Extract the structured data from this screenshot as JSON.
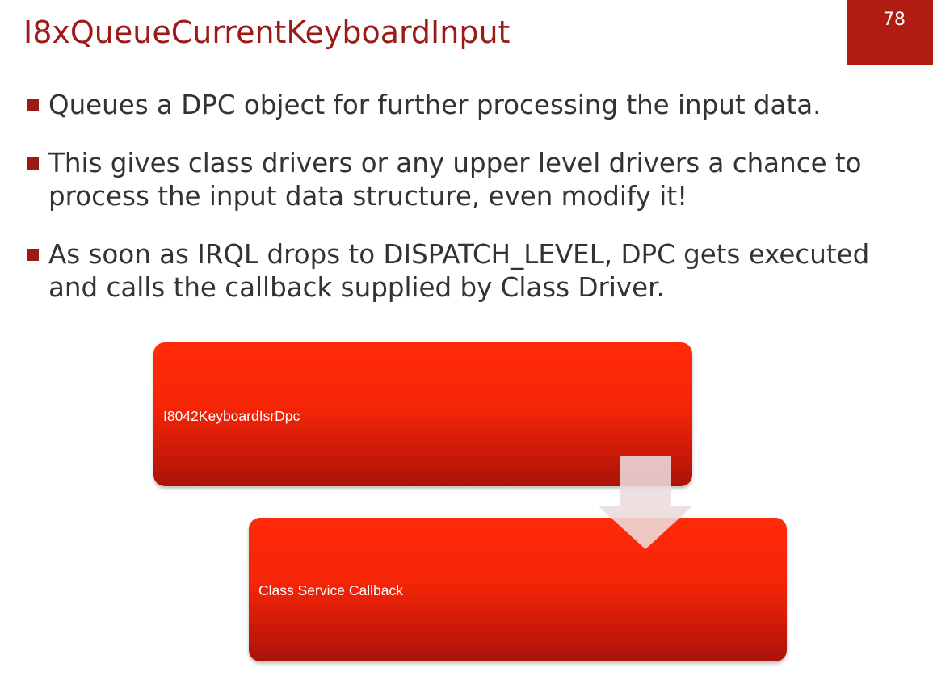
{
  "slide": {
    "title": "I8xQueueCurrentKeyboardInput",
    "page_number": "78",
    "accent_color": "#9b1b16",
    "badge_color": "#b01c12"
  },
  "bullets": [
    {
      "text": "Queues a DPC object for further processing the input data."
    },
    {
      "text": "This gives class drivers or any upper level drivers a chance to process the input data structure, even modify it!"
    },
    {
      "text": "As soon as IRQL drops to DISPATCH_LEVEL, DPC gets executed and calls the callback supplied by Class Driver."
    }
  ],
  "diagram": {
    "steps": [
      {
        "label": "I8042KeyboardIsrDpc"
      },
      {
        "label": "Class Service Callback"
      }
    ],
    "arrow_icon": "down-arrow-icon",
    "box_color": "#f52508"
  }
}
